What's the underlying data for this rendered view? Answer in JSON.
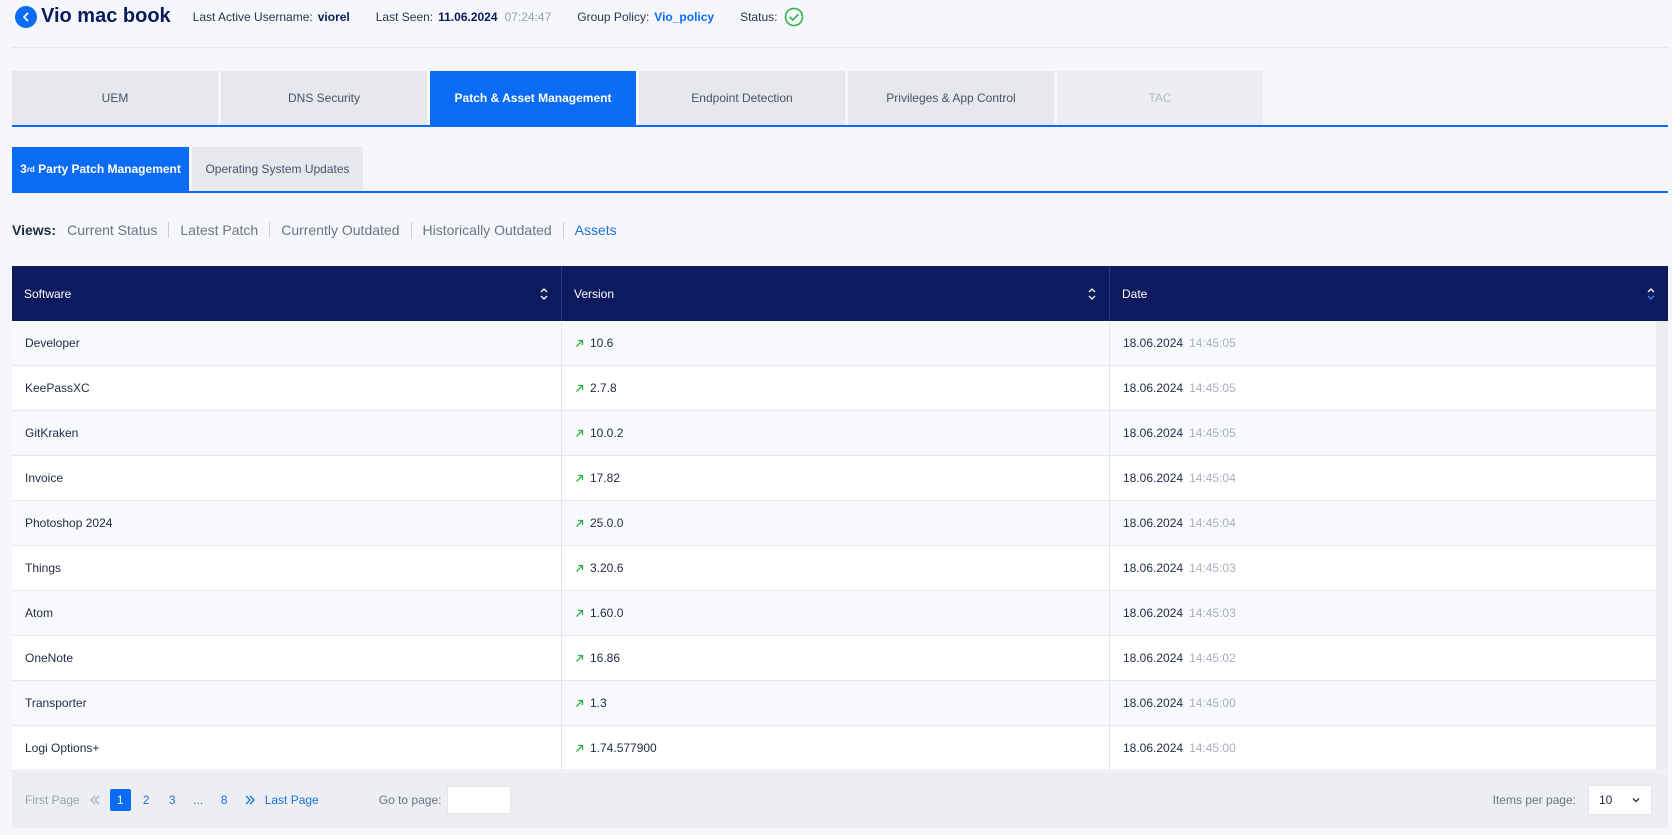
{
  "header": {
    "title": "Vio mac book",
    "last_active_label": "Last Active Username:",
    "last_active_value": "viorel",
    "last_seen_label": "Last Seen:",
    "last_seen_date": "11.06.2024",
    "last_seen_time": "07:24:47",
    "group_policy_label": "Group Policy:",
    "group_policy_value": "Vio_policy",
    "status_label": "Status:",
    "status_color": "#2fb344"
  },
  "main_tabs": [
    {
      "label": "UEM"
    },
    {
      "label": "DNS Security"
    },
    {
      "label": "Patch & Asset Management"
    },
    {
      "label": "Endpoint Detection"
    },
    {
      "label": "Privileges & App Control"
    },
    {
      "label": "TAC"
    }
  ],
  "sub_tabs": {
    "patch_prefix": "3",
    "patch_sup": "rd",
    "patch_suffix": " Party Patch Management",
    "os_updates": "Operating System Updates"
  },
  "views": {
    "label": "Views:",
    "items": [
      "Current Status",
      "Latest Patch",
      "Currently Outdated",
      "Historically Outdated",
      "Assets"
    ]
  },
  "table": {
    "headers": {
      "software": "Software",
      "version": "Version",
      "date": "Date"
    },
    "rows": [
      {
        "software": "Developer",
        "version": "10.6",
        "date": "18.06.2024",
        "time": "14:45:05"
      },
      {
        "software": "KeePassXC",
        "version": "2.7.8",
        "date": "18.06.2024",
        "time": "14:45:05"
      },
      {
        "software": "GitKraken",
        "version": "10.0.2",
        "date": "18.06.2024",
        "time": "14:45:05"
      },
      {
        "software": "Invoice",
        "version": "17.82",
        "date": "18.06.2024",
        "time": "14:45:04"
      },
      {
        "software": "Photoshop 2024",
        "version": "25.0.0",
        "date": "18.06.2024",
        "time": "14:45:04"
      },
      {
        "software": "Things",
        "version": "3.20.6",
        "date": "18.06.2024",
        "time": "14:45:03"
      },
      {
        "software": "Atom",
        "version": "1.60.0",
        "date": "18.06.2024",
        "time": "14:45:03"
      },
      {
        "software": "OneNote",
        "version": "16.86",
        "date": "18.06.2024",
        "time": "14:45:02"
      },
      {
        "software": "Transporter",
        "version": "1.3",
        "date": "18.06.2024",
        "time": "14:45:00"
      },
      {
        "software": "Logi Options+",
        "version": "1.74.577900",
        "date": "18.06.2024",
        "time": "14:45:00"
      }
    ]
  },
  "pagination": {
    "first_page": "First Page",
    "pages": [
      "1",
      "2",
      "3",
      "...",
      "8"
    ],
    "last_page": "Last Page",
    "goto_label": "Go to page:",
    "items_per_page_label": "Items per page:",
    "items_per_page_value": "10"
  }
}
